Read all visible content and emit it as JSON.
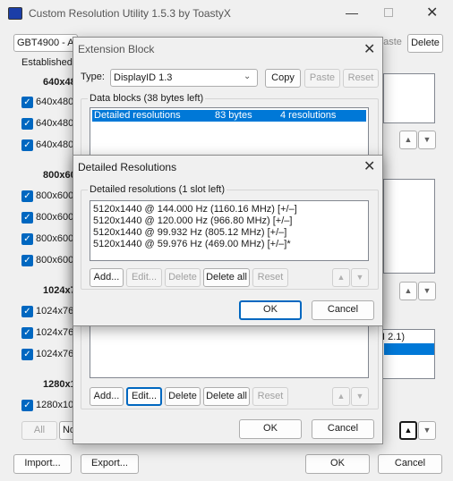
{
  "main": {
    "title": "Custom Resolution Utility 1.5.3 by ToastyX",
    "monitor": "GBT4900 - AO",
    "paste_label": "aste",
    "delete_label": "Delete",
    "established": "Established",
    "groups": [
      {
        "header": "640x48",
        "items": [
          "640x480",
          "640x480",
          "640x480"
        ]
      },
      {
        "header": "800x60",
        "items": [
          "800x600",
          "800x600",
          "800x600",
          "800x600"
        ]
      },
      {
        "header": "1024x7",
        "items": [
          "1024x76",
          "1024x76",
          "1024x76"
        ]
      },
      {
        "header": "1280x1",
        "items": [
          "1280x10"
        ]
      }
    ],
    "all_label": "All",
    "no_label": "No",
    "right_list_text": "I 2.1)",
    "import_label": "Import...",
    "export_label": "Export...",
    "ok_label": "OK",
    "cancel_label": "Cancel"
  },
  "ext": {
    "title": "Extension Block",
    "type_label": "Type:",
    "type_value": "DisplayID 1.3",
    "copy_label": "Copy",
    "paste_label": "Paste",
    "reset_label": "Reset",
    "data_blocks_label": "Data blocks (38 bytes left)",
    "block_row": {
      "name": "Detailed resolutions",
      "size": "83 bytes",
      "count": "4 resolutions"
    },
    "add_label": "Add...",
    "edit_label": "Edit...",
    "delete_label": "Delete",
    "delete_all_label": "Delete all",
    "reset2_label": "Reset",
    "ok_label": "OK",
    "cancel_label": "Cancel"
  },
  "detail": {
    "title": "Detailed Resolutions",
    "group_label": "Detailed resolutions (1 slot left)",
    "rows": [
      "5120x1440 @ 144.000 Hz (1160.16 MHz) [+/–]",
      "5120x1440 @ 120.000 Hz (966.80 MHz) [+/–]",
      "5120x1440 @ 99.932 Hz (805.12 MHz) [+/–]",
      "5120x1440 @ 59.976 Hz (469.00 MHz) [+/–]*"
    ],
    "add_label": "Add...",
    "edit_label": "Edit...",
    "delete_label": "Delete",
    "delete_all_label": "Delete all",
    "reset_label": "Reset",
    "ok_label": "OK",
    "cancel_label": "Cancel"
  },
  "icons": {
    "check": "checkmark-icon",
    "up": "arrow-up-icon",
    "down": "arrow-down-icon",
    "close": "close-icon",
    "dropdown": "chevron-down-icon",
    "app": "monitor-icon"
  },
  "colors": {
    "accent": "#0078d7",
    "focus": "#0067c0"
  }
}
